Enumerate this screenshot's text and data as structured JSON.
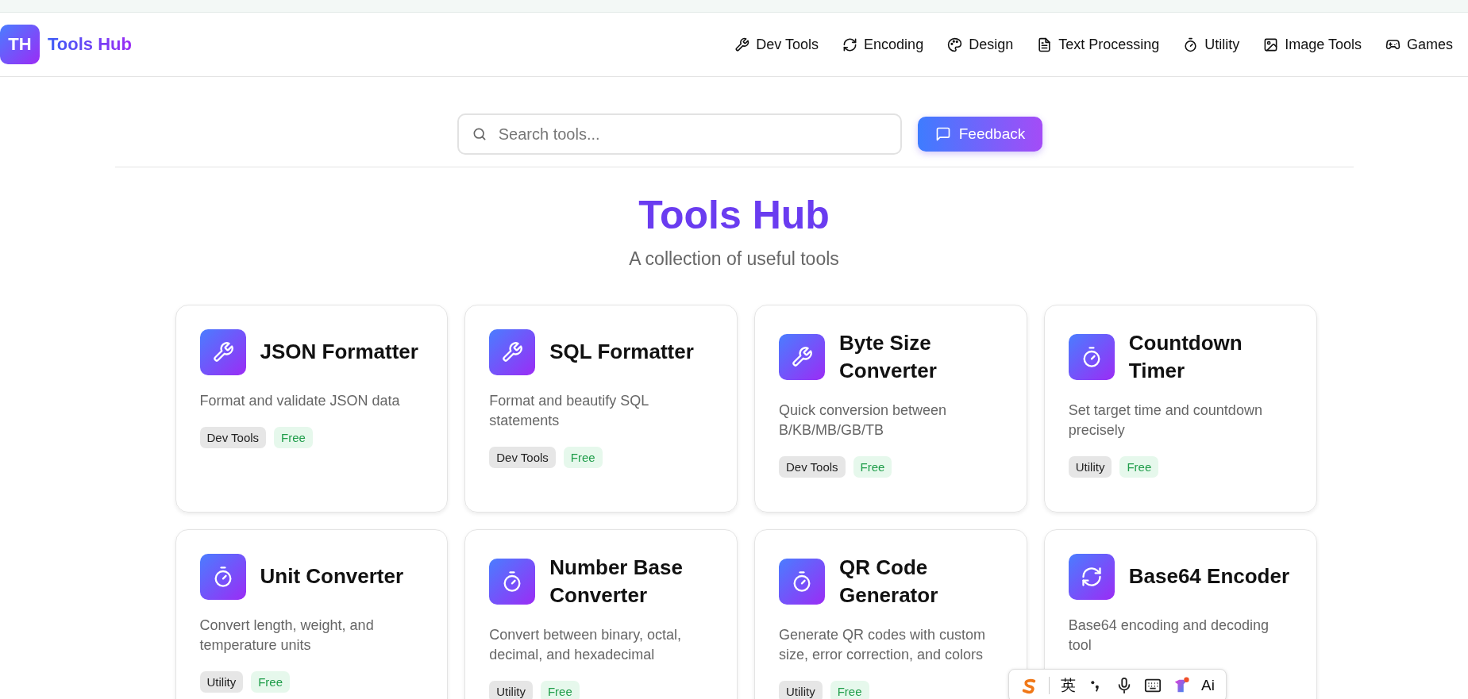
{
  "header": {
    "logo_mark": "TH",
    "brand": "Tools Hub",
    "nav": [
      {
        "label": "Dev Tools",
        "kind": "wrench"
      },
      {
        "label": "Encoding",
        "kind": "refresh"
      },
      {
        "label": "Design",
        "kind": "palette"
      },
      {
        "label": "Text Processing",
        "kind": "document"
      },
      {
        "label": "Utility",
        "kind": "timer"
      },
      {
        "label": "Image Tools",
        "kind": "image"
      },
      {
        "label": "Games",
        "kind": "gamepad"
      }
    ]
  },
  "search": {
    "placeholder": "Search tools..."
  },
  "feedback_button": "Feedback",
  "hero": {
    "title": "Tools Hub",
    "subtitle": "A collection of useful tools"
  },
  "tools": [
    {
      "kind": "wrench",
      "name": "JSON Formatter",
      "description": "Format and validate JSON data",
      "tags": [
        {
          "kind": "category",
          "label": "Dev Tools"
        },
        {
          "kind": "price",
          "label": "Free"
        }
      ]
    },
    {
      "kind": "wrench",
      "name": "SQL Formatter",
      "description": "Format and beautify SQL statements",
      "tags": [
        {
          "kind": "category",
          "label": "Dev Tools"
        },
        {
          "kind": "price",
          "label": "Free"
        }
      ]
    },
    {
      "kind": "wrench",
      "name": "Byte Size Converter",
      "description": "Quick conversion between B/KB/MB/GB/TB",
      "tags": [
        {
          "kind": "category",
          "label": "Dev Tools"
        },
        {
          "kind": "price",
          "label": "Free"
        }
      ]
    },
    {
      "kind": "timer",
      "name": "Countdown Timer",
      "description": "Set target time and countdown precisely",
      "tags": [
        {
          "kind": "category",
          "label": "Utility"
        },
        {
          "kind": "price",
          "label": "Free"
        }
      ]
    },
    {
      "kind": "timer",
      "name": "Unit Converter",
      "description": "Convert length, weight, and temperature units",
      "tags": [
        {
          "kind": "category",
          "label": "Utility"
        },
        {
          "kind": "price",
          "label": "Free"
        }
      ]
    },
    {
      "kind": "timer",
      "name": "Number Base Converter",
      "description": "Convert between binary, octal, decimal, and hexadecimal",
      "tags": [
        {
          "kind": "category",
          "label": "Utility"
        },
        {
          "kind": "price",
          "label": "Free"
        }
      ]
    },
    {
      "kind": "timer",
      "name": "QR Code Generator",
      "description": "Generate QR codes with custom size, error correction, and colors",
      "tags": [
        {
          "kind": "category",
          "label": "Utility"
        },
        {
          "kind": "price",
          "label": "Free"
        }
      ]
    },
    {
      "kind": "refresh",
      "name": "Base64 Encoder",
      "description": "Base64 encoding and decoding tool"
    }
  ],
  "ime_toolbar": {
    "language": "英",
    "ai": "Ai"
  }
}
